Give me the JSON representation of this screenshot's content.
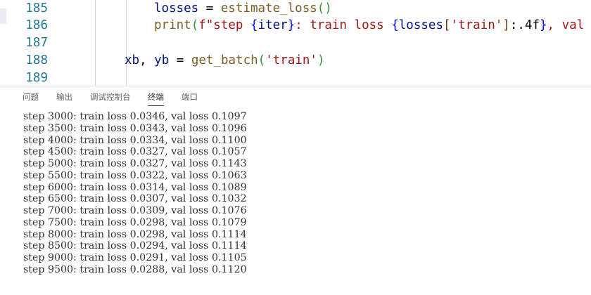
{
  "editor": {
    "lines": [
      {
        "number": "185",
        "indent": 4,
        "tokens": [
          {
            "t": "losses",
            "c": "t-var"
          },
          {
            "t": " = ",
            "c": "t-plain"
          },
          {
            "t": "estimate_loss",
            "c": "t-func"
          },
          {
            "t": "()",
            "c": "t-paren"
          }
        ]
      },
      {
        "number": "186",
        "indent": 4,
        "tokens": [
          {
            "t": "print",
            "c": "t-func"
          },
          {
            "t": "(",
            "c": "t-paren"
          },
          {
            "t": "f\"step ",
            "c": "t-str"
          },
          {
            "t": "{",
            "c": "t-brace"
          },
          {
            "t": "iter",
            "c": "t-var"
          },
          {
            "t": "}",
            "c": "t-brace"
          },
          {
            "t": ": train loss ",
            "c": "t-str"
          },
          {
            "t": "{",
            "c": "t-brace"
          },
          {
            "t": "losses",
            "c": "t-var"
          },
          {
            "t": "[",
            "c": "t-paren2"
          },
          {
            "t": "'train'",
            "c": "t-str"
          },
          {
            "t": "]",
            "c": "t-paren2"
          },
          {
            "t": ":.4f",
            "c": "t-plain"
          },
          {
            "t": "}",
            "c": "t-brace"
          },
          {
            "t": ", val l",
            "c": "t-str"
          }
        ]
      },
      {
        "number": "187",
        "indent": 0,
        "tokens": []
      },
      {
        "number": "188",
        "indent": 2,
        "tokens": [
          {
            "t": "xb",
            "c": "t-var"
          },
          {
            "t": ", ",
            "c": "t-plain"
          },
          {
            "t": "yb",
            "c": "t-var"
          },
          {
            "t": " = ",
            "c": "t-plain"
          },
          {
            "t": "get_batch",
            "c": "t-func"
          },
          {
            "t": "(",
            "c": "t-paren"
          },
          {
            "t": "'train'",
            "c": "t-str"
          },
          {
            "t": ")",
            "c": "t-paren"
          }
        ]
      },
      {
        "number": "189",
        "indent": 0,
        "tokens": []
      }
    ]
  },
  "panel": {
    "tabs": [
      {
        "label": "问题",
        "active": false
      },
      {
        "label": "输出",
        "active": false
      },
      {
        "label": "调试控制台",
        "active": false
      },
      {
        "label": "终端",
        "active": true
      },
      {
        "label": "端口",
        "active": false
      }
    ]
  },
  "terminal": {
    "lines": [
      "step 3000: train loss 0.0346, val loss 0.1097",
      "step 3500: train loss 0.0343, val loss 0.1096",
      "step 4000: train loss 0.0334, val loss 0.1100",
      "step 4500: train loss 0.0327, val loss 0.1057",
      "step 5000: train loss 0.0327, val loss 0.1143",
      "step 5500: train loss 0.0322, val loss 0.1063",
      "step 6000: train loss 0.0314, val loss 0.1089",
      "step 6500: train loss 0.0307, val loss 0.1032",
      "step 7000: train loss 0.0309, val loss 0.1076",
      "step 7500: train loss 0.0298, val loss 0.1079",
      "step 8000: train loss 0.0298, val loss 0.1114",
      "step 8500: train loss 0.0294, val loss 0.1114",
      "step 9000: train loss 0.0291, val loss 0.1105",
      "step 9500: train loss 0.0288, val loss 0.1120"
    ]
  }
}
